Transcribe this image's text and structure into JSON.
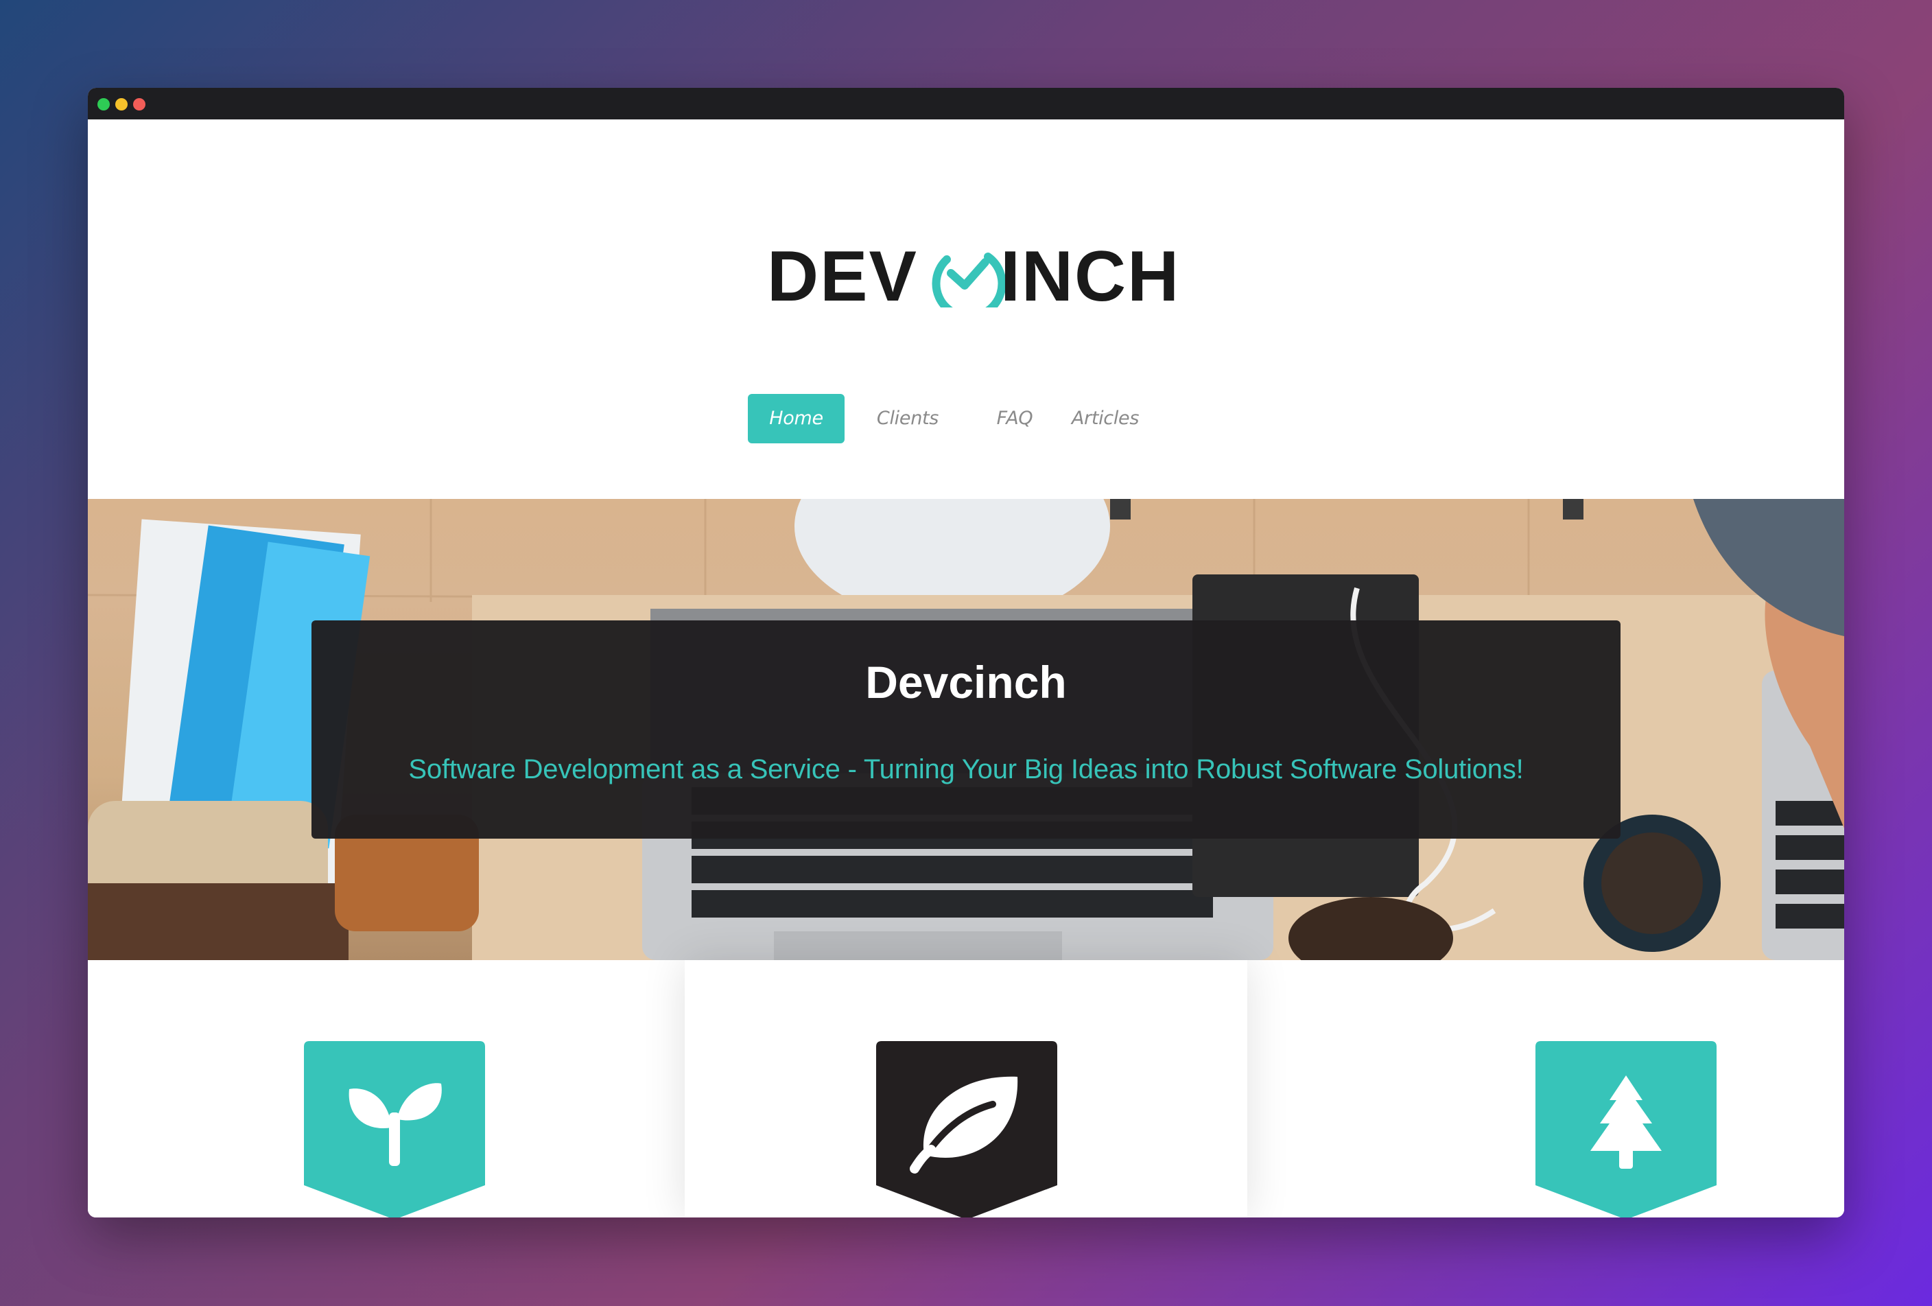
{
  "window": {
    "controls": [
      "close",
      "minimize",
      "maximize"
    ]
  },
  "logo": {
    "text_left": "DEV",
    "text_right": "INCH",
    "accent_color": "#37c4b9",
    "icon": "check-circle-icon"
  },
  "nav": {
    "items": [
      {
        "label": "Home",
        "active": true
      },
      {
        "label": "Clients",
        "active": false
      },
      {
        "label": "FAQ",
        "active": false
      },
      {
        "label": "Articles",
        "active": false
      }
    ]
  },
  "hero": {
    "title": "Devcinch",
    "subtitle": "Software Development as a Service - Turning Your Big Ideas into Robust Software Solutions!"
  },
  "features": {
    "cards": [
      {
        "icon": "sprout-icon",
        "color": "#37c4b9"
      },
      {
        "icon": "leaf-icon",
        "color": "#231f20"
      },
      {
        "icon": "tree-icon",
        "color": "#37c4b9"
      }
    ]
  },
  "colors": {
    "accent": "#37c4b9",
    "dark": "#231f20",
    "nav_text": "#8a8a8a"
  }
}
